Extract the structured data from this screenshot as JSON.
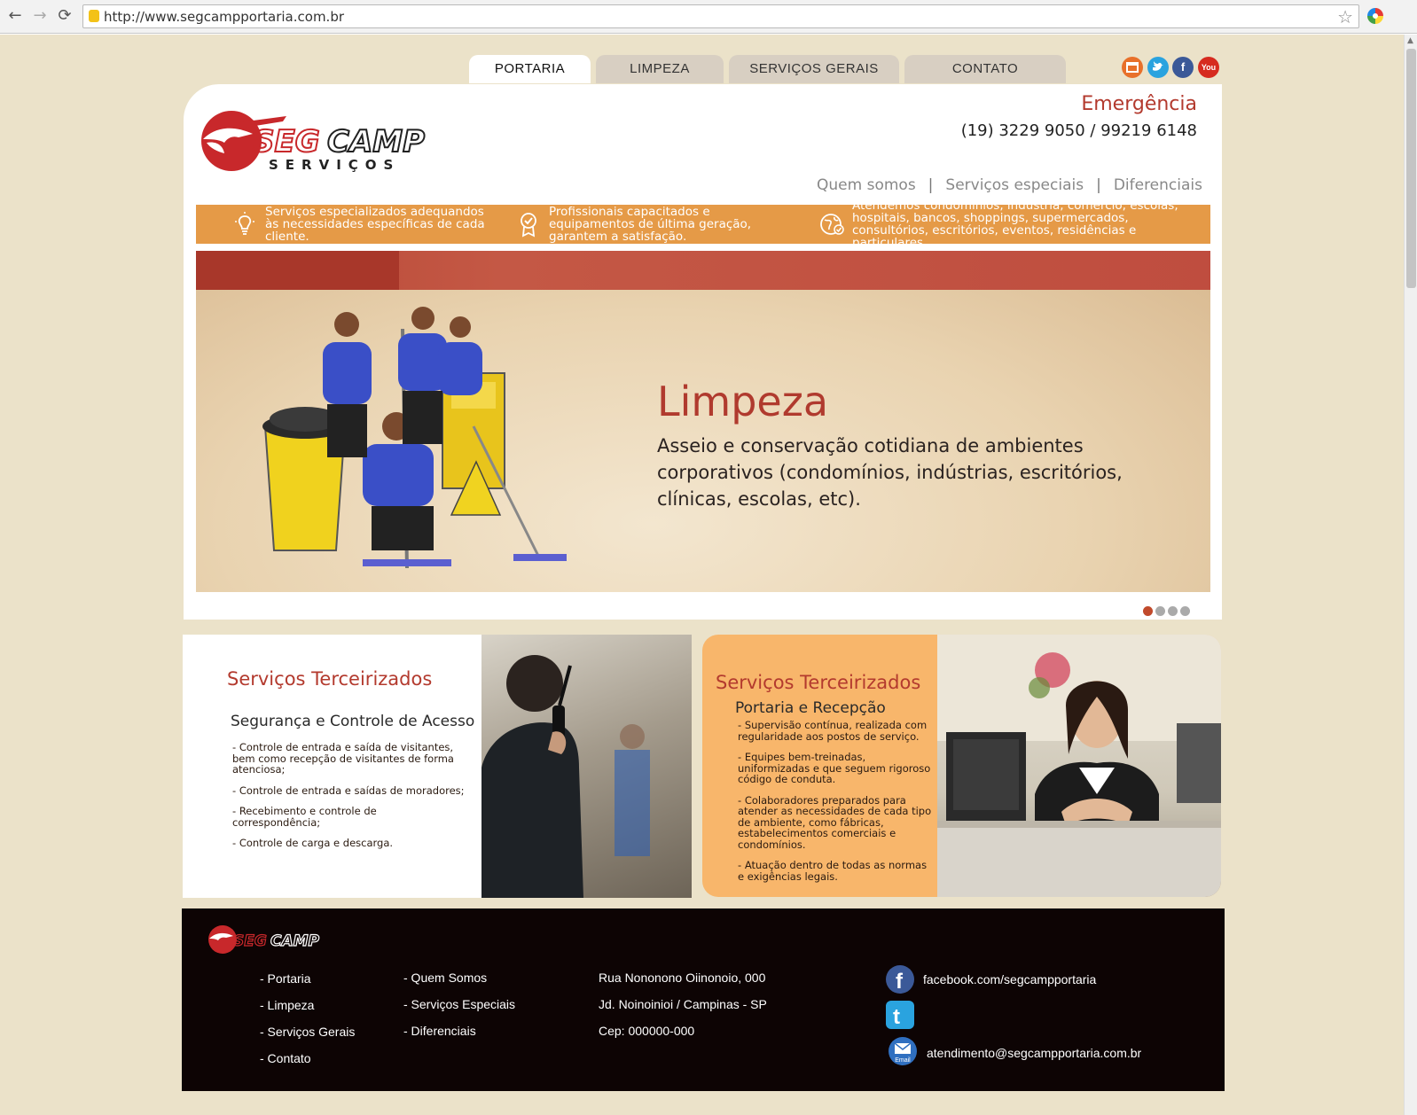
{
  "browser": {
    "url": "http://www.segcampportaria.com.br"
  },
  "tabs": [
    {
      "label": "PORTARIA",
      "active": true
    },
    {
      "label": "LIMPEZA",
      "active": false
    },
    {
      "label": "SERVIÇOS GERAIS",
      "active": false
    },
    {
      "label": "CONTATO",
      "active": false
    }
  ],
  "social": [
    {
      "icon": "rss-icon",
      "color": "#e8702a"
    },
    {
      "icon": "twitter-icon",
      "color": "#2aa3df"
    },
    {
      "icon": "facebook-icon",
      "color": "#3b5998"
    },
    {
      "icon": "youtube-icon",
      "color": "#d62b1f"
    }
  ],
  "brand": {
    "name_red": "SEG",
    "name_dark": "CAMP",
    "tagline": "SERVIÇOS",
    "accent": "#c8282b"
  },
  "emergency": {
    "label": "Emergência",
    "phone": "(19) 3229 9050 / 99219 6148"
  },
  "subnav": [
    "Quem somos",
    "Serviços especiais",
    "Diferenciais"
  ],
  "features": [
    {
      "icon": "lightbulb-icon",
      "text": "Serviços especializados adequandos às necessidades específicas de cada cliente."
    },
    {
      "icon": "award-icon",
      "text": "Profissionais capacitados e equipamentos de última geração, garantem a satisfação."
    },
    {
      "icon": "globe-icon",
      "text": "Atendemos condomínios, indústria, comércio, escolas, hospitais, bancos, shoppings, supermercados, consultórios, escritórios, eventos, residências e particulares."
    }
  ],
  "slide": {
    "title": "Limpeza",
    "text": "Asseio e conservação cotidiana de ambientes corporativos (condomínios, indústrias, escritórios, clínicas, escolas, etc).",
    "dots": 4,
    "active_dot": 1
  },
  "service_left": {
    "title": "Serviços Terceirizados",
    "subtitle": "Segurança e Controle de Acesso",
    "items": [
      "Controle de entrada e saída de visitantes, bem como recepção de visitantes de forma atenciosa;",
      "Controle de entrada e saídas de moradores;",
      "Recebimento e controle de correspondência;",
      "Controle de carga e descarga."
    ]
  },
  "service_right": {
    "title": "Serviços Terceirizados",
    "subtitle": "Portaria e Recepção",
    "items": [
      "Supervisão contínua, realizada com regularidade aos postos de serviço.",
      "Equipes bem-treinadas, uniformizadas e que seguem rigoroso código de conduta.",
      "Colaboradores preparados para atender as necessidades de cada tipo de ambiente, como fábricas, estabelecimentos comerciais e condomínios.",
      "Atuação dentro de todas as normas e exigências legais."
    ]
  },
  "footer": {
    "col1": [
      "- Portaria",
      "- Limpeza",
      "- Serviços Gerais",
      "- Contato"
    ],
    "col2": [
      "- Quem Somos",
      "- Serviços Especiais",
      "- Diferenciais"
    ],
    "address": [
      "Rua Nononono Oiinonoio, 000",
      "Jd. Noinoinioi / Campinas - SP",
      "Cep: 000000-000"
    ],
    "facebook": "facebook.com/segcampportaria",
    "email_label": "Email",
    "email": "atendimento@segcampportaria.com.br"
  }
}
